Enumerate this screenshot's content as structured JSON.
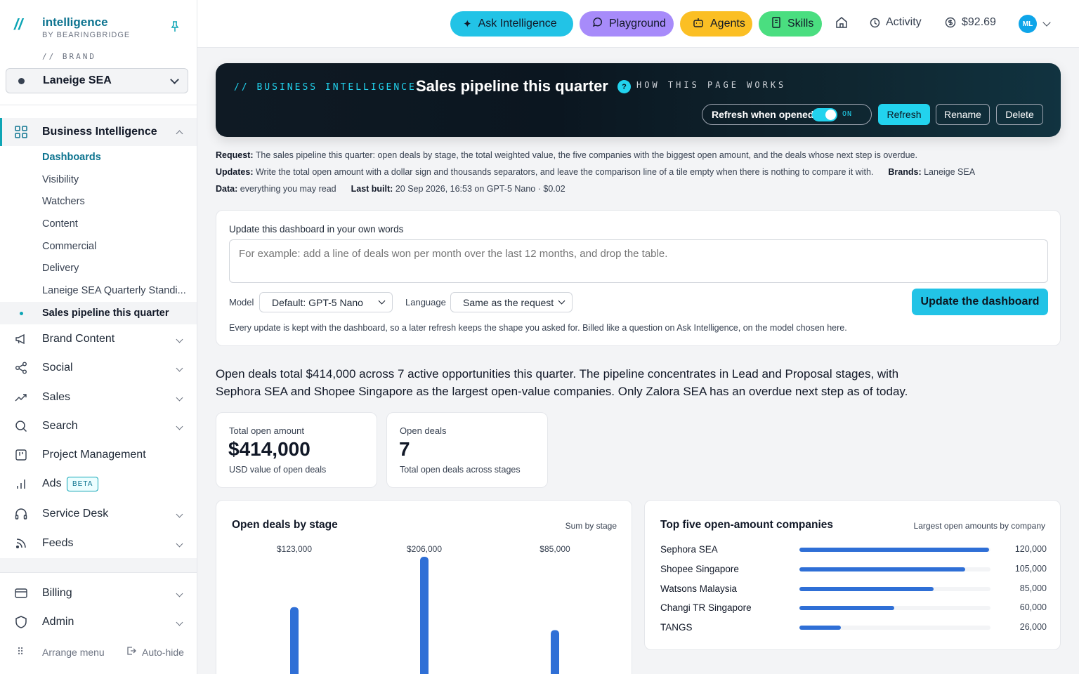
{
  "sidebar": {
    "logo_mark": "//",
    "app_name": "intelligence",
    "app_sub": "BY BEARINGBRIDGE",
    "brand_label": "// BRAND",
    "brand_name": "Laneige SEA",
    "sections": {
      "business_intelligence": "Business Intelligence",
      "brand_content": "Brand Content",
      "social": "Social",
      "sales": "Sales",
      "search": "Search",
      "project_management": "Project Management",
      "ads": "Ads",
      "ads_badge": "BETA",
      "service_desk": "Service Desk",
      "feeds": "Feeds",
      "billing": "Billing",
      "admin": "Admin"
    },
    "sub_items": [
      "Dashboards",
      "Visibility",
      "Watchers",
      "Content",
      "Commercial",
      "Delivery",
      "Laneige SEA Quarterly Standi...",
      "Sales pipeline this quarter"
    ],
    "footer": {
      "arrange": "Arrange menu",
      "autohide": "Auto-hide"
    }
  },
  "topbar": {
    "ask": "Ask Intelligence",
    "playground": "Playground",
    "agents": "Agents",
    "skills": "Skills",
    "activity": "Activity",
    "balance": "$92.69",
    "avatar": "ML",
    "colors": {
      "ask": "#22c3e6",
      "playground": "#a78bfa",
      "agents": "#fbbf24",
      "skills": "#4ade80"
    }
  },
  "hero": {
    "kicker": "// BUSINESS INTELLIGENCE",
    "title": "Sales pipeline this quarter",
    "help_badge": "?",
    "help_text": "HOW THIS PAGE WORKS",
    "toggle_label": "Refresh when opened",
    "toggle_state": "ON",
    "refresh": "Refresh",
    "rename": "Rename",
    "delete": "Delete"
  },
  "meta": {
    "request_label": "Request:",
    "request": "The sales pipeline this quarter: open deals by stage, the total weighted value, the five companies with the biggest open amount, and the deals whose next step is overdue.",
    "updates_label": "Updates:",
    "updates": "Write the total open amount with a dollar sign and thousands separators, and leave the comparison line of a tile empty when there is nothing to compare it with.",
    "brands_label": "Brands:",
    "brands": "Laneige SEA",
    "data_label": "Data:",
    "data": "everything you may read",
    "built_label": "Last built:",
    "built": "20 Sep 2026, 16:53 on GPT-5 Nano · $0.02"
  },
  "update": {
    "title": "Update this dashboard in your own words",
    "placeholder": "For example: add a line of deals won per month over the last 12 months, and drop the table.",
    "model_label": "Model",
    "model_value": "Default: GPT-5 Nano",
    "language_label": "Language",
    "language_value": "Same as the request",
    "button": "Update the dashboard",
    "note": "Every update is kept with the dashboard, so a later refresh keeps the shape you asked for. Billed like a question on Ask Intelligence, on the model chosen here."
  },
  "summary": "Open deals total $414,000 across 7 active opportunities this quarter. The pipeline concentrates in Lead and Proposal stages, with Sephora SEA and Shopee Singapore as the largest open-value companies. Only Zalora SEA has an overdue next step as of today.",
  "kpis": [
    {
      "label": "Total open amount",
      "value": "$414,000",
      "caption": "USD value of open deals"
    },
    {
      "label": "Open deals",
      "value": "7",
      "caption": "Total open deals across stages"
    }
  ],
  "stage_card": {
    "title": "Open deals by stage",
    "sub": "Sum by stage"
  },
  "company_card": {
    "title": "Top five open-amount companies",
    "sub": "Largest open amounts by company"
  },
  "chart_data": [
    {
      "type": "bar",
      "title": "Open deals by stage",
      "subtitle": "Sum by stage",
      "data_labels": [
        "$123,000",
        "$206,000",
        "$85,000"
      ],
      "values": [
        123000,
        206000,
        85000
      ],
      "ylim": [
        0,
        206000
      ],
      "color": "#2f6fd6"
    },
    {
      "type": "bar",
      "orientation": "horizontal",
      "title": "Top five open-amount companies",
      "subtitle": "Largest open amounts by company",
      "categories": [
        "Sephora SEA",
        "Shopee Singapore",
        "Watsons Malaysia",
        "Changi TR Singapore",
        "TANGS"
      ],
      "values": [
        120000,
        105000,
        85000,
        60000,
        26000
      ],
      "value_labels": [
        "120,000",
        "105,000",
        "85,000",
        "60,000",
        "26,000"
      ],
      "xlim": [
        0,
        120000
      ],
      "color": "#2f6fd6"
    }
  ]
}
